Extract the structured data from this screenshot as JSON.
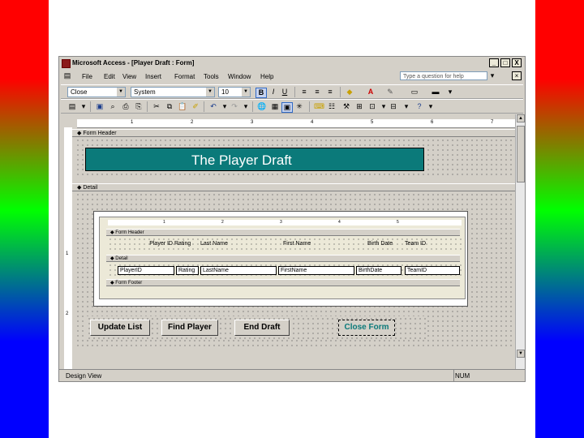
{
  "window": {
    "title": "Microsoft Access - [Player Draft : Form]",
    "controls": [
      "_",
      "□",
      "X"
    ]
  },
  "menu": {
    "items": [
      "File",
      "Edit",
      "View",
      "Insert",
      "Format",
      "Tools",
      "Window",
      "Help"
    ],
    "ask_placeholder": "Type a question for help"
  },
  "formatting_toolbar": {
    "object": "Close",
    "font": "System",
    "size": "10",
    "bold": "B",
    "italic": "I",
    "underline": "U"
  },
  "ruler": {
    "marks": [
      "1",
      "2",
      "3",
      "4",
      "5",
      "6",
      "7"
    ],
    "vmarks": [
      "1",
      "2"
    ]
  },
  "form": {
    "header_section": "Form Header",
    "header_label": "The Player Draft",
    "detail_section": "Detail"
  },
  "subform": {
    "ruler_marks": [
      "1",
      "2",
      "3",
      "4",
      "5"
    ],
    "form_header": "Form Header",
    "detail": "Detail",
    "form_footer": "Form Footer",
    "headers": [
      "Player ID",
      "Rating",
      "Last Name",
      "First Name",
      "Birth Date",
      "Team ID"
    ],
    "fields": [
      "PlayerID",
      "Rating",
      "LastName",
      "FirstName",
      "BirthDate",
      "TeamID"
    ]
  },
  "buttons": {
    "update": "Update List",
    "find": "Find Player",
    "end": "End Draft",
    "close": "Close Form"
  },
  "status": {
    "mode": "Design View",
    "num": "NUM"
  },
  "colors": {
    "header_fill": "#0b7a7a",
    "header_text": "#ffffff"
  }
}
